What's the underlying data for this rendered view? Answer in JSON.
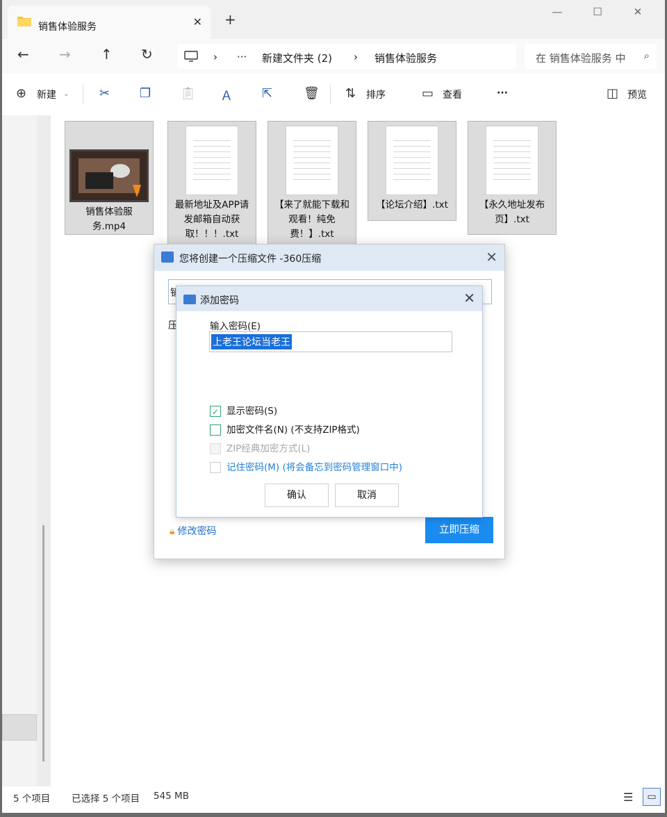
{
  "window": {
    "tab_title": "销售体验服务",
    "new_tab": "+",
    "minimize": "—",
    "maximize": "☐",
    "close": "✕"
  },
  "nav": {
    "back": "←",
    "forward": "→",
    "up": "↑",
    "refresh": "↻",
    "breadcrumb": [
      "新建文件夹 (2)",
      "销售体验服务"
    ],
    "more": "···",
    "search_placeholder": "在 销售体验服务 中搜索"
  },
  "toolbar": {
    "new_label": "新建",
    "sort_label": "排序",
    "view_label": "查看",
    "more": "···",
    "preview_label": "预览"
  },
  "files": [
    {
      "name": "销售体验服务.mp4",
      "type": "video"
    },
    {
      "name": "最新地址及APP请发邮箱自动获取！！！.txt",
      "type": "text"
    },
    {
      "name": "【来了就能下载和观看！纯免费！】.txt",
      "type": "text"
    },
    {
      "name": "【论坛介绍】.txt",
      "type": "text"
    },
    {
      "name": "【永久地址发布页】.txt",
      "type": "text"
    }
  ],
  "status": {
    "count": "5 个项目",
    "selected": "已选择 5 个项目",
    "size": "545 MB"
  },
  "compress_dialog": {
    "title": "您将创建一个压缩文件 -360压缩",
    "field_initial": "销",
    "label_initial": "压",
    "change_password": "修改密码",
    "start_button": "立即压缩"
  },
  "password_dialog": {
    "title": "添加密码",
    "input_label": "输入密码(E)",
    "password_value": "上老王论坛当老王",
    "show_password": "显示密码(S)",
    "encrypt_names": "加密文件名(N) (不支持ZIP格式)",
    "zip_classic": "ZIP经典加密方式(L)",
    "remember": "记住密码(M) (将会备忘到密码管理窗口中)",
    "ok": "确认",
    "cancel": "取消"
  }
}
